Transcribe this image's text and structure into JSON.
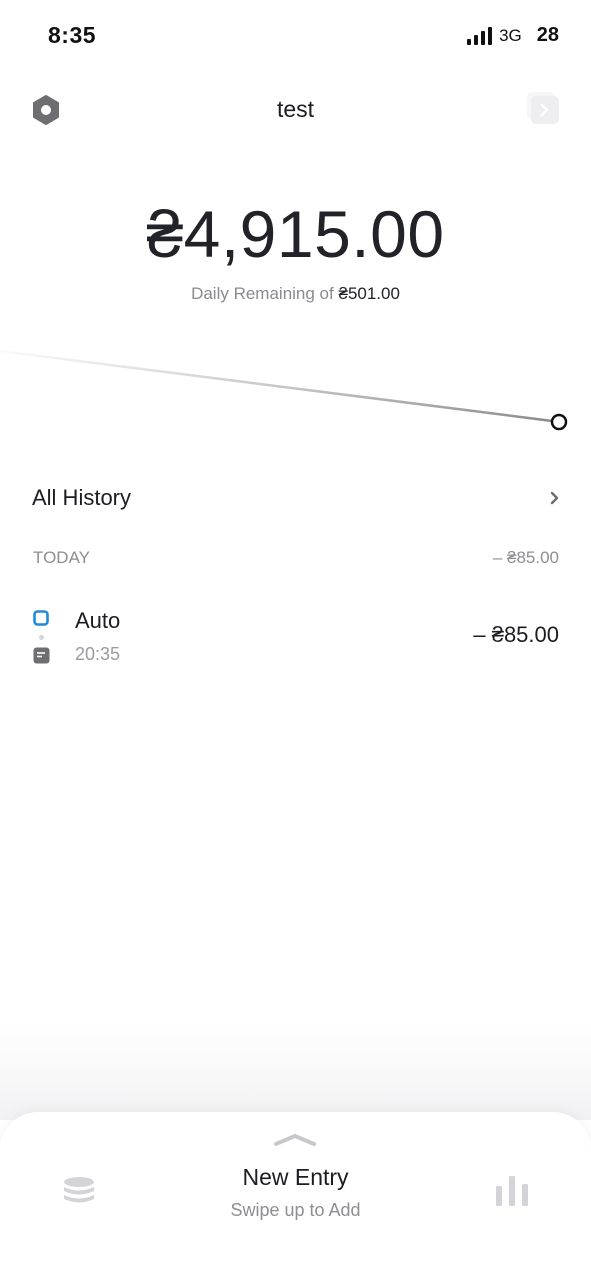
{
  "status_bar": {
    "time": "8:35",
    "network": "3G",
    "battery": "28"
  },
  "header": {
    "title": "test",
    "settings_icon": "settings-hexagon-icon",
    "next_icon": "chevron-right-icon"
  },
  "summary": {
    "balance": "₴4,915.00",
    "daily_prefix": "Daily Remaining of",
    "daily_amount": "₴501.00"
  },
  "history": {
    "label": "All History",
    "chevron_icon": "chevron-right-icon"
  },
  "day_group": {
    "label": "TODAY",
    "total": "– ₴85.00"
  },
  "entries": [
    {
      "name": "Auto",
      "time": "20:35",
      "amount": "– ₴85.00",
      "category_icon": "square-outline-icon",
      "category_color": "#1e8ad8",
      "note_icon": "note-icon"
    }
  ],
  "bottom_sheet": {
    "title": "New Entry",
    "subtitle": "Swipe up to Add",
    "left_icon": "coins-stack-icon",
    "right_icon": "bar-chart-icon",
    "grabber_icon": "chevron-up-icon"
  },
  "colors": {
    "accent": "#1e8ad8",
    "text": "#1c1c22",
    "muted": "#8e8e93",
    "icon_gray": "#d4d4d8"
  }
}
